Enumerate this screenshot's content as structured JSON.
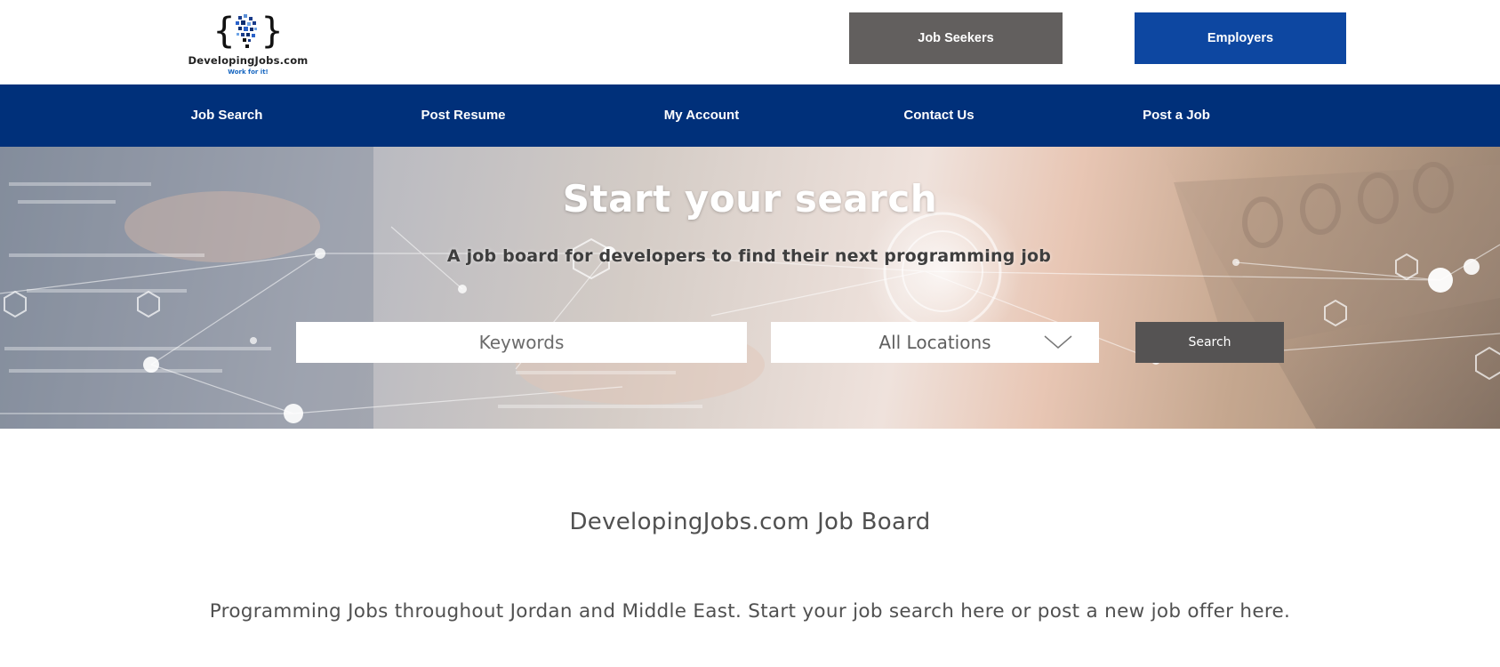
{
  "header": {
    "logo": {
      "icon": "code-braces-pixel-logo",
      "name": "DevelopingJobs.com",
      "tagline": "Work for it!"
    },
    "job_seekers_label": "Job Seekers",
    "employers_label": "Employers"
  },
  "nav": {
    "items": [
      {
        "label": "Job Search"
      },
      {
        "label": "Post Resume"
      },
      {
        "label": "My Account"
      },
      {
        "label": "Contact Us"
      },
      {
        "label": "Post a Job"
      }
    ]
  },
  "hero": {
    "title": "Start your search",
    "subtitle": "A job board for developers to find their next programming job",
    "keywords_placeholder": "Keywords",
    "location_selected": "All Locations",
    "search_label": "Search"
  },
  "content": {
    "board_title": "DevelopingJobs.com Job Board",
    "intro": "Programming Jobs throughout Jordan and Middle East. Start your job search here or post a new job offer here."
  },
  "colors": {
    "nav_bg": "#00307a",
    "employers_bg": "#0d47a1",
    "job_seekers_bg": "#625f5e",
    "search_btn_bg": "#555353"
  }
}
